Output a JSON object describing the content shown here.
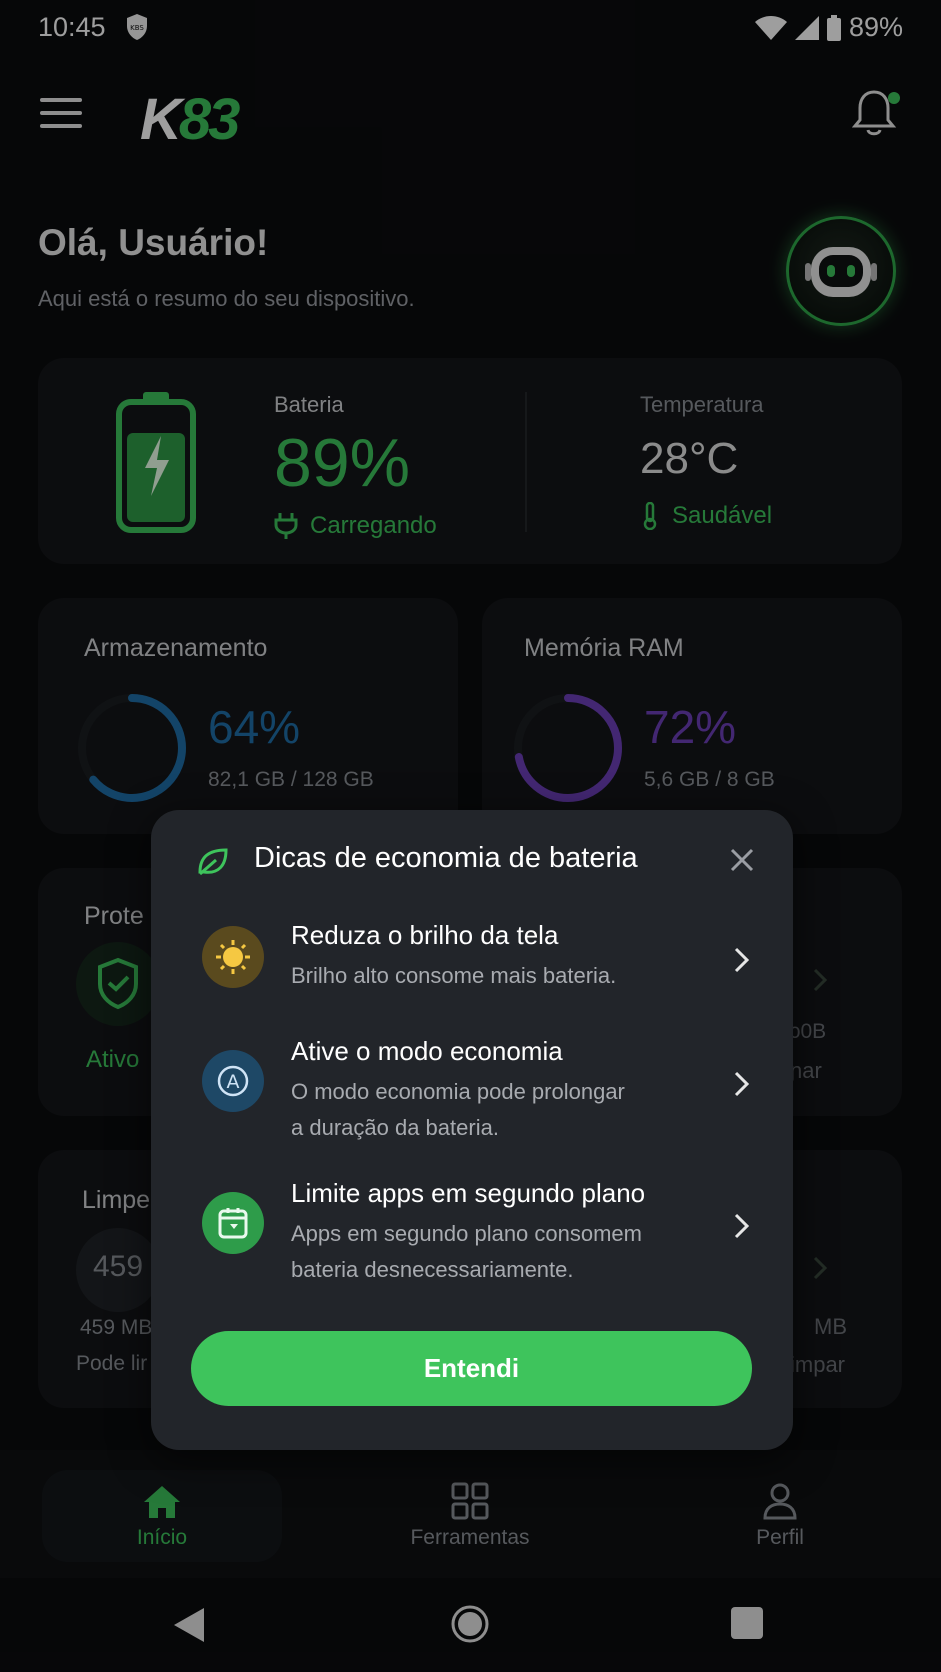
{
  "status_bar": {
    "time": "10:45",
    "badge": "KBS",
    "battery": "89%"
  },
  "app": {
    "logo_k": "K",
    "logo_num": "83",
    "accent": "#3ec45c"
  },
  "greeting": {
    "title": "Olá, Usuário!",
    "subtitle": "Aqui está o resumo do seu dispositivo."
  },
  "battery": {
    "label": "Bateria",
    "value": "89%",
    "level": 0.89,
    "status": "Carregando"
  },
  "temperature": {
    "label": "Temperatura",
    "value": "28°C",
    "status": "Saudável"
  },
  "storage": {
    "title": "Armazenamento",
    "percent": "64%",
    "fraction": 0.64,
    "detail": "82,1 GB / 128 GB",
    "color": "#1f6fa8"
  },
  "ram": {
    "title": "Memória RAM",
    "percent": "72%",
    "fraction": 0.72,
    "detail": "5,6 GB / 8 GB",
    "color": "#6c3fb8"
  },
  "protection": {
    "title_partial": "Prote",
    "status": "Ativo",
    "right_partial_1": "ɔ0B",
    "right_partial_2": "ɲar"
  },
  "cleanup": {
    "title_partial": "Limpe",
    "ring_value": "459",
    "size_partial": "459 MB",
    "action_partial": "Pode lir",
    "right_size_partial": "MB",
    "right_action_partial": "impar"
  },
  "dialog": {
    "title": "Dicas de economia de bateria",
    "tips": [
      {
        "title": "Reduza o brilho da tela",
        "desc_1": "Brilho alto consome mais bateria.",
        "desc_2": "",
        "icon": "sun-icon"
      },
      {
        "title": "Ative o modo economia",
        "desc_1": "O modo economia pode prolongar",
        "desc_2": "a duração da bateria.",
        "icon": "power-saving-icon"
      },
      {
        "title": "Limite apps em segundo plano",
        "desc_1": "Apps em segundo plano consomem",
        "desc_2": "bateria desnecessariamente.",
        "icon": "background-apps-icon"
      }
    ],
    "confirm": "Entendi"
  },
  "nav": {
    "home": "Início",
    "tools": "Ferramentas",
    "profile": "Perfil"
  }
}
